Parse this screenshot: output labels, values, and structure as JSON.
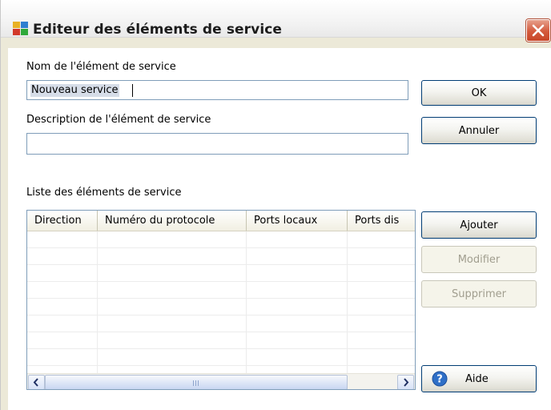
{
  "window": {
    "title": "Editeur des éléments de service"
  },
  "form": {
    "name_label": "Nom de l'élément de service",
    "name_value": "Nouveau service",
    "description_label": "Description de l'élément de service",
    "description_value": "",
    "list_label": "Liste des éléments de service"
  },
  "buttons": {
    "ok": "OK",
    "cancel": "Annuler",
    "add": "Ajouter",
    "modify": "Modifier",
    "delete": "Supprimer",
    "help": "Aide"
  },
  "list": {
    "columns": [
      "Direction",
      "Numéro du protocole",
      "Ports locaux",
      "Ports dis"
    ],
    "rows": []
  },
  "colors": {
    "close_button": "#d4593c",
    "help_icon": "#2f6fc7",
    "input_border": "#7f9db9"
  }
}
